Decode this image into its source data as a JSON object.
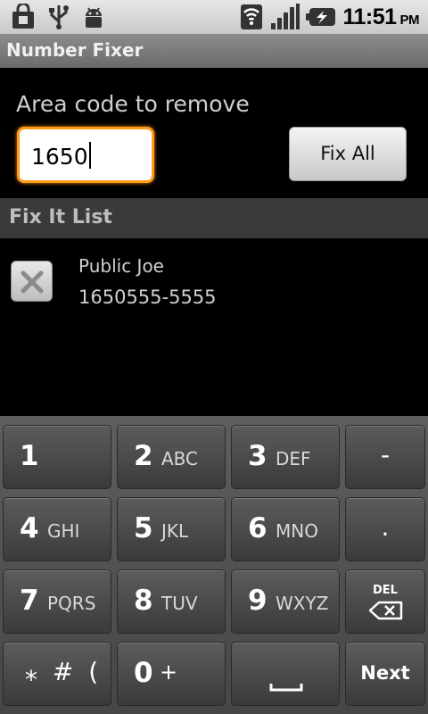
{
  "status_bar": {
    "time": "11:51",
    "ampm": "PM",
    "icons": [
      "shopping-bag-icon",
      "usb-icon",
      "android-debug-icon",
      "wifi-icon",
      "signal-icon",
      "battery-charging-icon"
    ]
  },
  "app": {
    "title": "Number Fixer"
  },
  "area_code": {
    "label": "Area code to remove",
    "value": "1650"
  },
  "fix_all_button": {
    "label": "Fix All"
  },
  "list_header": {
    "label": "Fix It List"
  },
  "list": {
    "items": [
      {
        "name": "Public Joe",
        "number": "1650555-5555"
      }
    ]
  },
  "keyboard": {
    "keys": [
      {
        "num": "1",
        "letters": ""
      },
      {
        "num": "2",
        "letters": "ABC"
      },
      {
        "num": "3",
        "letters": "DEF"
      },
      {
        "sym": "-"
      },
      {
        "num": "4",
        "letters": "GHI"
      },
      {
        "num": "5",
        "letters": "JKL"
      },
      {
        "num": "6",
        "letters": "MNO"
      },
      {
        "sym": "."
      },
      {
        "num": "7",
        "letters": "PQRS"
      },
      {
        "num": "8",
        "letters": "TUV"
      },
      {
        "num": "9",
        "letters": "WXYZ"
      },
      {
        "del": "DEL"
      },
      {
        "star": "⁎ # ("
      },
      {
        "num": "0",
        "letters": "+"
      },
      {
        "space": "space"
      },
      {
        "action": "Next"
      }
    ]
  }
}
